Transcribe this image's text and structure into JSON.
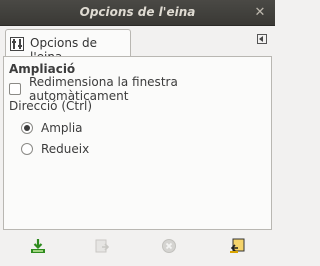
{
  "window": {
    "title": "Opcions de l'eina"
  },
  "tab": {
    "label": "Opcions de l'eina"
  },
  "options": {
    "section_title": "Ampliació",
    "resize_window_label": "Redimensiona la finestra automàticament",
    "resize_window_checked": false,
    "direction_label": "Direcció (Ctrl)",
    "direction_options": [
      {
        "label": "Amplia",
        "selected": true
      },
      {
        "label": "Redueix",
        "selected": false
      }
    ]
  },
  "bottom_buttons": [
    {
      "icon": "save-icon",
      "enabled": true
    },
    {
      "icon": "restore-icon",
      "enabled": false
    },
    {
      "icon": "delete-icon",
      "enabled": false
    },
    {
      "icon": "reset-icon",
      "enabled": true
    }
  ],
  "colors": {
    "titlebar": "#3c3b37",
    "accent_green": "#2e8b1e",
    "accent_orange": "#d9a400"
  }
}
